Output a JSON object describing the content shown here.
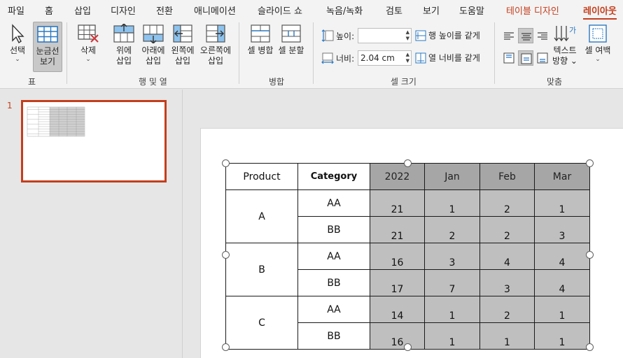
{
  "tabs": [
    "파일",
    "홈",
    "삽입",
    "디자인",
    "전환",
    "애니메이션",
    "슬라이드 쇼",
    "녹음/녹화",
    "검토",
    "보기",
    "도움말",
    "테이블 디자인",
    "레이아웃"
  ],
  "ribbon": {
    "groups": {
      "table": {
        "label": "표",
        "select": "선택",
        "gridlines_l1": "눈금선",
        "gridlines_l2": "보기"
      },
      "rows_cols": {
        "label": "행 및 열",
        "delete": "삭제",
        "insert_above_l1": "위에",
        "insert_above_l2": "삽입",
        "insert_below_l1": "아래에",
        "insert_below_l2": "삽입",
        "insert_left_l1": "왼쪽에",
        "insert_left_l2": "삽입",
        "insert_right_l1": "오른쪽에",
        "insert_right_l2": "삽입"
      },
      "merge": {
        "label": "병합",
        "merge_cells": "셀 병합",
        "split_cells": "셀 분할"
      },
      "cell_size": {
        "label": "셀 크기",
        "height_label": "높이:",
        "height_value": "",
        "width_label": "너비:",
        "width_value": "2.04 cm",
        "distribute_rows": "행 높이를 같게",
        "distribute_cols": "열 너비를 같게"
      },
      "alignment": {
        "label": "맞춤",
        "text_direction_l1": "텍스트",
        "text_direction_l2": "방향",
        "cell_margins": "셀 여백"
      }
    }
  },
  "thumbnails": [
    {
      "number": "1"
    }
  ],
  "table": {
    "headers": [
      "Product",
      "Category",
      "2022",
      "Jan",
      "Feb",
      "Mar"
    ],
    "rows": [
      {
        "product": "A",
        "category": "AA",
        "values": [
          "21",
          "1",
          "2",
          "1"
        ]
      },
      {
        "product": "",
        "category": "BB",
        "values": [
          "21",
          "2",
          "2",
          "3"
        ]
      },
      {
        "product": "B",
        "category": "AA",
        "values": [
          "16",
          "3",
          "4",
          "4"
        ]
      },
      {
        "product": "",
        "category": "BB",
        "values": [
          "17",
          "7",
          "3",
          "4"
        ]
      },
      {
        "product": "C",
        "category": "AA",
        "values": [
          "14",
          "1",
          "2",
          "1"
        ]
      },
      {
        "product": "",
        "category": "BB",
        "values": [
          "16",
          "1",
          "1",
          "1"
        ]
      }
    ]
  },
  "colors": {
    "accent": "#c43e1c",
    "header_dark": "#a6a6a6",
    "cell_dark": "#bfbfbf",
    "ribbon_bg": "#f3f3f3",
    "workspace_bg": "#e6e6e6"
  }
}
